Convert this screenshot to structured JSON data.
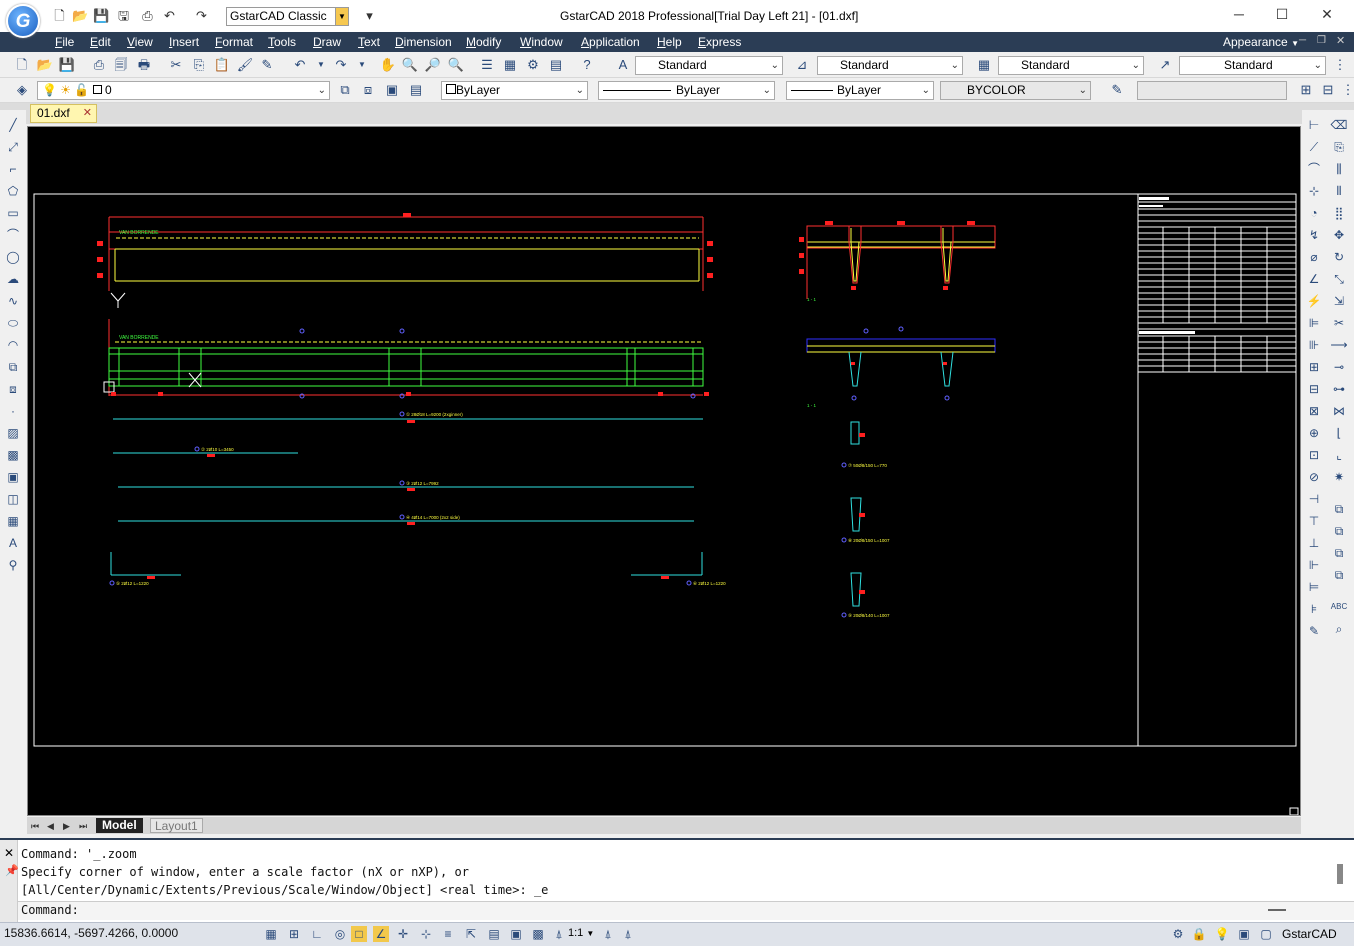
{
  "window": {
    "title": "GstarCAD 2018 Professional[Trial Day Left 21] - [01.dxf]",
    "workspace": "GstarCAD Classic",
    "logo_letter": "G"
  },
  "menu": [
    "File",
    "Edit",
    "View",
    "Insert",
    "Format",
    "Tools",
    "Draw",
    "Text",
    "Dimension",
    "Modify",
    "Window",
    "Application",
    "Help",
    "Express"
  ],
  "appearance_label": "Appearance",
  "styles_toolbar": {
    "text_style": "Standard",
    "dim_style": "Standard",
    "table_style": "Standard",
    "mleader_style": "Standard"
  },
  "layers_toolbar": {
    "layer": "0",
    "color": "ByLayer",
    "linetype": "ByLayer",
    "lineweight": "ByLayer",
    "plotstyle": "BYCOLOR"
  },
  "document_tab": "01.dxf",
  "layout_tabs": [
    "Model",
    "Layout1"
  ],
  "command_history": [
    "Command: '_.zoom",
    "Specify corner of window, enter a scale factor (nX or nXP), or",
    "[All/Center/Dynamic/Extents/Previous/Scale/Window/Object] <real time>: _e"
  ],
  "command_prompt": "Command:",
  "status": {
    "coordinates": "15836.6614, -5697.4266, 0.0000",
    "annotation_scale": "1:1",
    "brand": "GstarCAD"
  },
  "drawing": {
    "labels": {
      "beam_label_1": "VAN BORRENDE",
      "beam_label_2": "VAN BORRENDE",
      "section_1": "1 - 1 ",
      "section_2": "1 - 1 ",
      "bar_1": "① 28Ø18 L=9200 (2xginner)",
      "bar_2": "② 2Ø10 L=3450",
      "bar_3": "③ 2Ø12 L=7992",
      "bar_4": "④ 4Ø14 L=7000 (2x2 side)",
      "bar_5": "⑤ 2Ø12 L=1220",
      "bar_6": "⑥ 2Ø12 L=1220",
      "stirrup_1": "⑦ 50Ø8/150 L=770",
      "stirrup_2": "⑧ 20Ø8/150 L=1007",
      "stirrup_3": "⑨ 20Ø8/140 L=1007"
    }
  }
}
